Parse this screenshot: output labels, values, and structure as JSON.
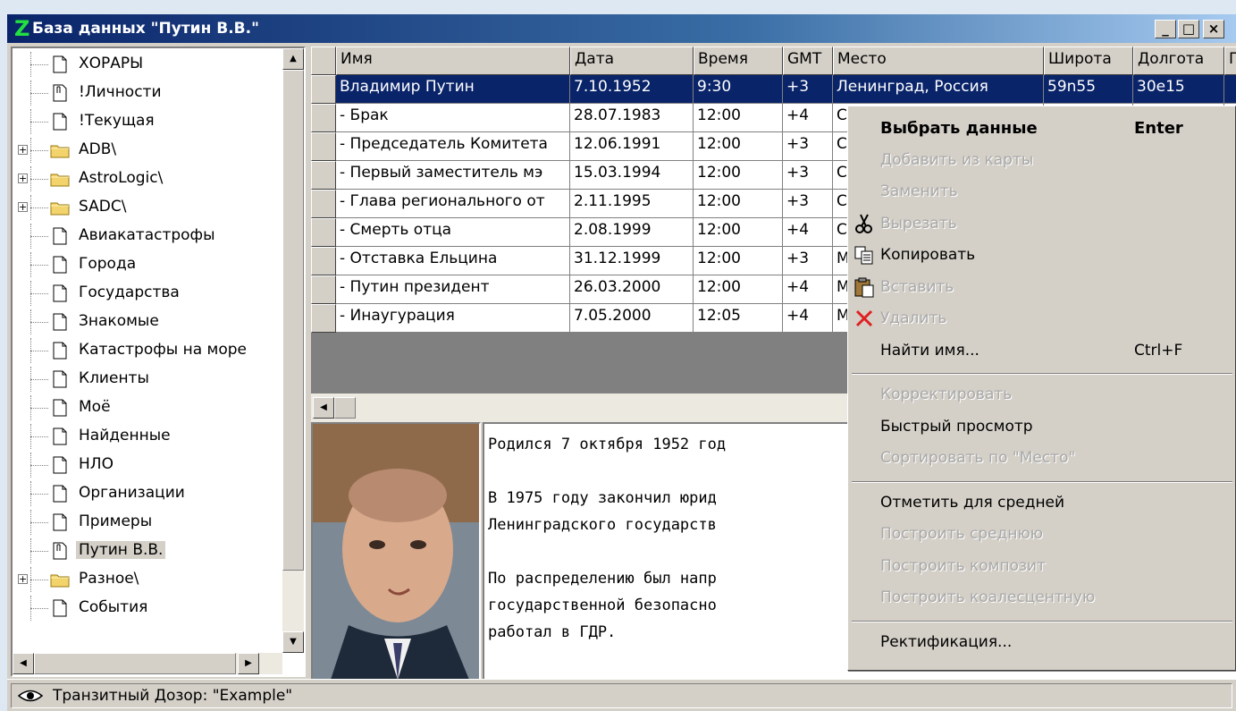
{
  "window": {
    "app_icon": "Z",
    "title": "База данных \"Путин В.В.\"",
    "minimize": "_",
    "maximize": "□",
    "close": "×"
  },
  "tree": {
    "items": [
      {
        "label": "ХОРАРЫ",
        "icon": "document-icon",
        "expandable": false
      },
      {
        "label": "!Личности",
        "icon": "folded-document-icon",
        "expandable": false
      },
      {
        "label": "!Текущая",
        "icon": "document-icon",
        "expandable": false
      },
      {
        "label": "ADB\\",
        "icon": "folder-icon",
        "expandable": true
      },
      {
        "label": "AstroLogic\\",
        "icon": "folder-icon",
        "expandable": true
      },
      {
        "label": "SADC\\",
        "icon": "folder-icon",
        "expandable": true
      },
      {
        "label": "Авиакатастрофы",
        "icon": "document-icon",
        "expandable": false
      },
      {
        "label": "Города",
        "icon": "document-icon",
        "expandable": false
      },
      {
        "label": "Государства",
        "icon": "document-icon",
        "expandable": false
      },
      {
        "label": "Знакомые",
        "icon": "document-icon",
        "expandable": false
      },
      {
        "label": "Катастрофы на море",
        "icon": "document-icon",
        "expandable": false
      },
      {
        "label": "Клиенты",
        "icon": "document-icon",
        "expandable": false
      },
      {
        "label": "Моё",
        "icon": "document-icon",
        "expandable": false
      },
      {
        "label": "Найденные",
        "icon": "document-icon",
        "expandable": false
      },
      {
        "label": "НЛО",
        "icon": "document-icon",
        "expandable": false
      },
      {
        "label": "Организации",
        "icon": "document-icon",
        "expandable": false
      },
      {
        "label": "Примеры",
        "icon": "document-icon",
        "expandable": false
      },
      {
        "label": "Путин В.В.",
        "icon": "folded-document-icon",
        "expandable": false,
        "selected": true
      },
      {
        "label": "Разное\\",
        "icon": "folder-icon",
        "expandable": true
      },
      {
        "label": "События",
        "icon": "document-icon",
        "expandable": false
      }
    ],
    "expand_glyph": "+",
    "scroll_up": "▲",
    "scroll_down": "▼",
    "scroll_left": "◀",
    "scroll_right": "▶"
  },
  "grid": {
    "columns": [
      "Имя",
      "Дата",
      "Время",
      "GMT",
      "Место",
      "Широта",
      "Долгота",
      "П"
    ],
    "rows": [
      [
        "Владимир Путин",
        "7.10.1952",
        "9:30",
        "+3",
        "Ленинград, Россия",
        "59n55",
        "30e15"
      ],
      [
        "- Брак",
        "28.07.1983",
        "12:00",
        "+4",
        "С",
        "",
        ""
      ],
      [
        "- Председатель Комитета",
        "12.06.1991",
        "12:00",
        "+3",
        "С",
        "",
        ""
      ],
      [
        "- Первый заместитель мэ",
        "15.03.1994",
        "12:00",
        "+3",
        "С",
        "",
        ""
      ],
      [
        "- Глава регионального от",
        "2.11.1995",
        "12:00",
        "+3",
        "С",
        "",
        ""
      ],
      [
        "- Смерть отца",
        "2.08.1999",
        "12:00",
        "+4",
        "С",
        "",
        ""
      ],
      [
        "- Отставка Ельцина",
        "31.12.1999",
        "12:00",
        "+3",
        "М",
        "",
        ""
      ],
      [
        "- Путин президент",
        "26.03.2000",
        "12:00",
        "+4",
        "М",
        "",
        ""
      ],
      [
        "- Инаугурация",
        "7.05.2000",
        "12:05",
        "+4",
        "М",
        "",
        ""
      ]
    ],
    "scroll_left": "◀"
  },
  "notes": {
    "lines": [
      "Родился 7 октября 1952 год",
      "",
      "В 1975 году закончил юрид",
      "Ленинградского государств",
      "",
      "По распределению был напр",
      "государственной безопасно",
      "работал в ГДР."
    ]
  },
  "status": {
    "text": "Транзитный Дозор: \"Example\""
  },
  "context_menu": {
    "items": [
      {
        "label": "Выбрать данные",
        "shortcut": "Enter",
        "bold": true,
        "disabled": false
      },
      {
        "label": "Добавить из карты",
        "disabled": true
      },
      {
        "label": "Заменить",
        "disabled": true
      },
      {
        "label": "Вырезать",
        "disabled": true,
        "icon": "scissors-icon"
      },
      {
        "label": "Копировать",
        "disabled": false,
        "icon": "copy-icon"
      },
      {
        "label": "Вставить",
        "disabled": true,
        "icon": "paste-icon"
      },
      {
        "label": "Удалить",
        "disabled": true,
        "icon": "delete-icon"
      },
      {
        "label": "Найти имя...",
        "shortcut": "Ctrl+F",
        "disabled": false
      },
      {
        "separator": true
      },
      {
        "label": "Корректировать",
        "disabled": true
      },
      {
        "label": "Быстрый просмотр",
        "disabled": false
      },
      {
        "label": "Сортировать по \"Место\"",
        "disabled": true
      },
      {
        "separator": true
      },
      {
        "label": "Отметить для средней",
        "disabled": false
      },
      {
        "label": "Построить среднюю",
        "disabled": true
      },
      {
        "label": "Построить композит",
        "disabled": true
      },
      {
        "label": "Построить коалесцентную",
        "disabled": true
      },
      {
        "separator": true
      },
      {
        "label": "Ректификация...",
        "disabled": false
      }
    ]
  },
  "colors": {
    "selection": "#0a246a",
    "disabled_text": "#a8a8a8",
    "delete_icon": "#e02020"
  }
}
